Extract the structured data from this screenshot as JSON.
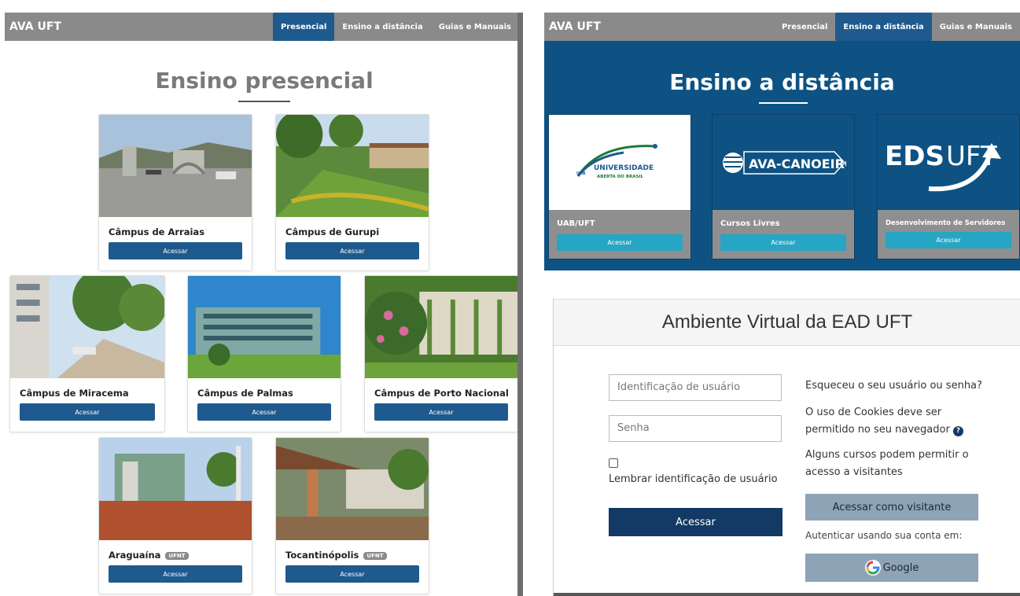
{
  "left": {
    "brand": "AVA UFT",
    "nav": [
      "Presencial",
      "Ensino a distância",
      "Guias e Manuais"
    ],
    "heading": "Ensino presencial",
    "campuses": [
      {
        "name": "Câmpus de Arraias",
        "button": "Acessar",
        "badge": ""
      },
      {
        "name": "Câmpus de Gurupi",
        "button": "Acessar",
        "badge": ""
      },
      {
        "name": "Câmpus de Miracema",
        "button": "Acessar",
        "badge": ""
      },
      {
        "name": "Câmpus de Palmas",
        "button": "Acessar",
        "badge": ""
      },
      {
        "name": "Câmpus de Porto Nacional",
        "button": "Acessar",
        "badge": ""
      },
      {
        "name": "Araguaína",
        "button": "Acessar",
        "badge": "UFNT"
      },
      {
        "name": "Tocantinópolis",
        "button": "Acessar",
        "badge": "UFNT"
      }
    ]
  },
  "right_top": {
    "brand": "AVA UFT",
    "nav": [
      "Presencial",
      "Ensino a distância",
      "Guias e Manuais"
    ],
    "heading": "Ensino a distância",
    "cards": [
      {
        "title": "UAB/UFT",
        "button": "Acessar",
        "logo_main": "UNIVERSIDADE",
        "logo_sub": "ABERTA DO BRASIL",
        "logo_mark": "UAB"
      },
      {
        "title": "Cursos Livres",
        "button": "Acessar",
        "logo_main": "AVA-CANOEIRO"
      },
      {
        "title": "Desenvolvimento de Servidores",
        "button": "Acessar",
        "logo_main": "EDS",
        "logo_accent": "UFT"
      }
    ]
  },
  "login": {
    "title": "Ambiente Virtual da EAD UFT",
    "username_placeholder": "Identificação de usuário",
    "password_placeholder": "Senha",
    "remember_label": "Lembrar identificação de usuário",
    "submit": "Acessar",
    "forgot": "Esqueceu o seu usuário ou senha?",
    "cookies": "O uso de Cookies deve ser permitido no seu navegador",
    "guests": "Alguns cursos podem permitir o acesso a visitantes",
    "guest_button": "Acessar como visitante",
    "auth_with": "Autenticar usando sua conta em:",
    "google": "Google"
  },
  "colors": {
    "primary": "#1e5a8e",
    "bar": "#8a8a8a",
    "dist_bg": "#0e5283",
    "teal": "#26a6c4",
    "login_btn": "#123a64",
    "guest_btn": "#8fa3b6"
  }
}
